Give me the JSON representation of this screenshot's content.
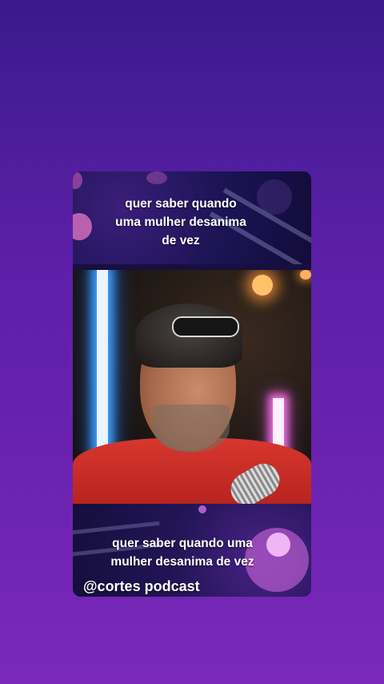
{
  "top_caption": {
    "line1": "quer saber quando",
    "line2": "uma mulher desanima",
    "line3": "de vez"
  },
  "bottom_caption": {
    "line1": "quer saber quando uma",
    "line2": "mulher desanima de vez"
  },
  "channel": {
    "handle": "@cortes podcast"
  },
  "colors": {
    "background_top": "#3a1a8c",
    "background_bottom": "#7a29b8",
    "shirt": "#d7372e",
    "neon_blue": "#3fa5ff",
    "neon_pink": "#f06fe0"
  }
}
